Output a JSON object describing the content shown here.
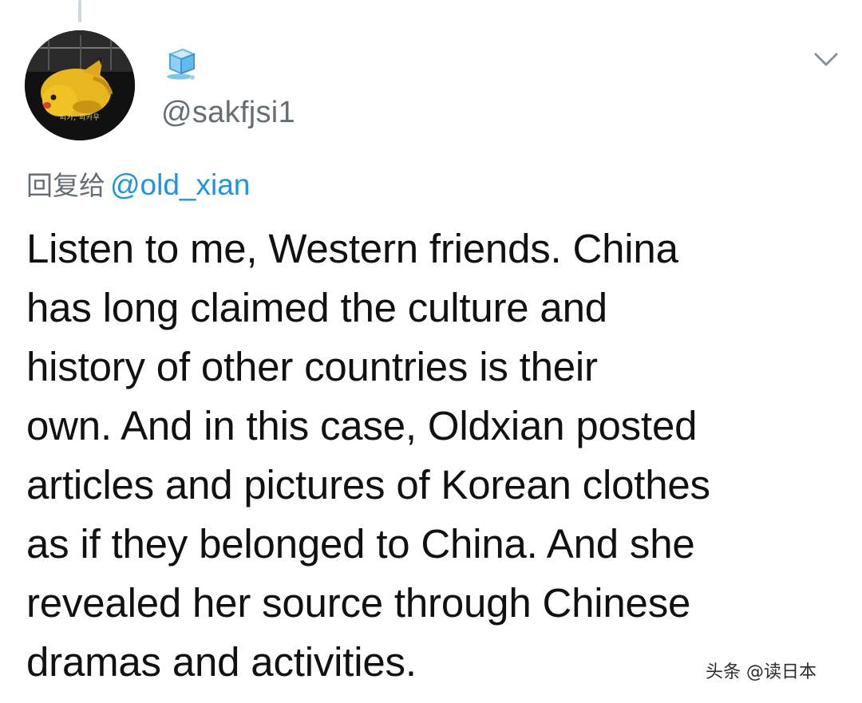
{
  "thread": {
    "has_connector_line": true
  },
  "author": {
    "avatar_icon": "pikachu-avatar",
    "avatar_caption": "피카, 피카우",
    "display_name_icon": "ice-cube-emoji",
    "handle": "@sakfjsi1"
  },
  "menu": {
    "icon": "chevron-down-icon"
  },
  "reply": {
    "prefix": "回复给",
    "mention": "@old_xian"
  },
  "tweet": {
    "lines": [
      "Listen to me, Western friends. China",
      "has long claimed the culture and",
      "history of other countries is their",
      "own. And in this case, Oldxian posted",
      "articles and pictures of Korean clothes",
      "as if they belonged to China. And she",
      "revealed her source through Chinese",
      "dramas and activities."
    ]
  },
  "watermark": {
    "text": "头条 @读日本"
  },
  "colors": {
    "link": "#1b95e0",
    "muted": "#666d73",
    "text": "#111111"
  }
}
